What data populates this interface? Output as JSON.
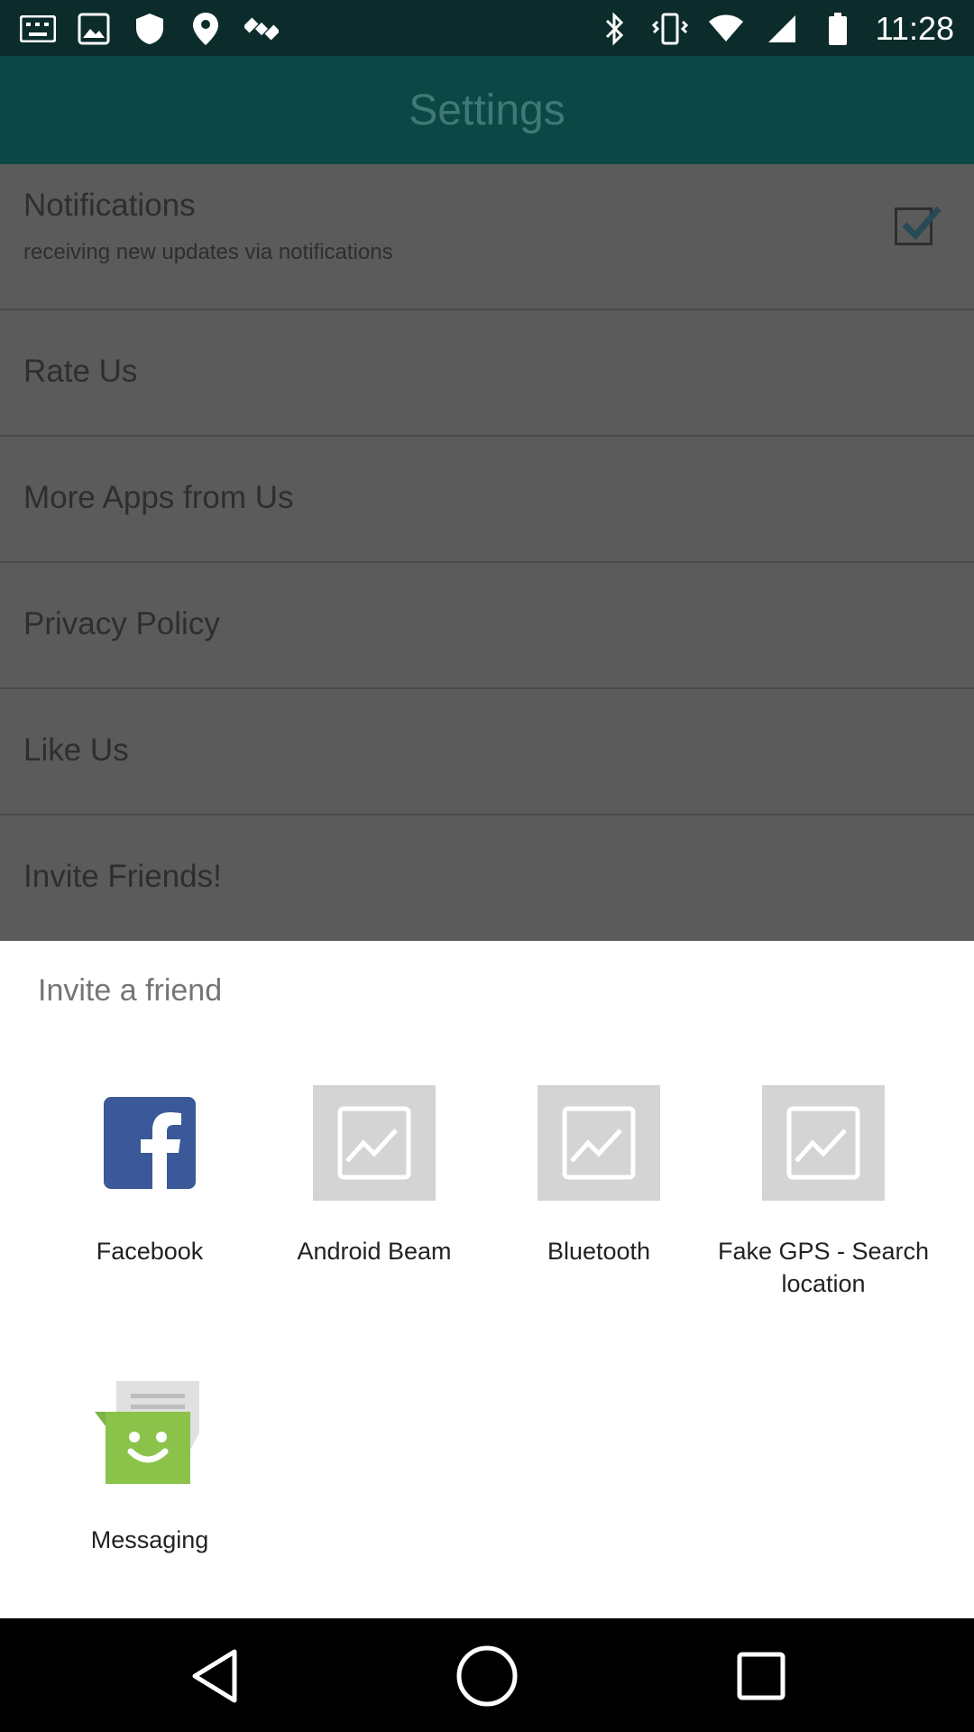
{
  "status_bar": {
    "time": "11:28",
    "left_icons": [
      "keyboard-icon",
      "photo-icon",
      "shield-icon",
      "fake-gps-icon",
      "satellite-icon"
    ],
    "right_icons": [
      "bluetooth-icon",
      "vibrate-icon",
      "wifi-icon",
      "signal-icon",
      "battery-icon"
    ]
  },
  "app_bar": {
    "title": "Settings"
  },
  "settings": {
    "notifications": {
      "title": "Notifications",
      "subtitle": "receiving new updates via notifications",
      "checked": true
    },
    "items": [
      {
        "label": "Rate Us"
      },
      {
        "label": "More Apps from Us"
      },
      {
        "label": "Privacy Policy"
      },
      {
        "label": "Like Us"
      },
      {
        "label": "Invite Friends!"
      }
    ]
  },
  "share_sheet": {
    "title": "Invite a friend",
    "apps": [
      {
        "label": "Facebook",
        "icon": "facebook-icon"
      },
      {
        "label": "Android Beam",
        "icon": "image-placeholder-icon"
      },
      {
        "label": "Bluetooth",
        "icon": "image-placeholder-icon"
      },
      {
        "label": "Fake GPS - Search location",
        "icon": "image-placeholder-icon"
      },
      {
        "label": "Messaging",
        "icon": "messaging-icon"
      }
    ]
  },
  "nav_bar": {
    "buttons": [
      "back-icon",
      "home-icon",
      "recents-icon"
    ]
  },
  "colors": {
    "status_bar": "#0b2c2b",
    "app_bar": "#0b4745",
    "scrim_bg": "#5b5b5b",
    "sheet_bg": "#ffffff",
    "facebook_blue": "#3b5998",
    "messaging_green": "#8bc34a"
  }
}
